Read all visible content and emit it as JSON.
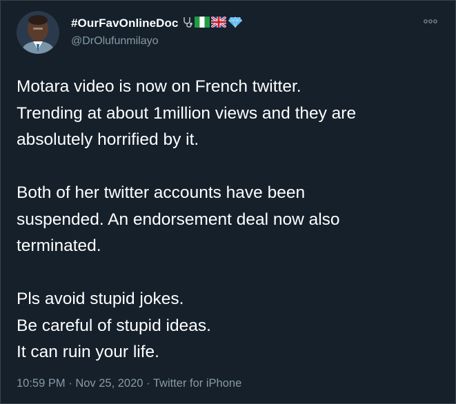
{
  "author": {
    "display_name": "#OurFavOnlineDoc",
    "handle": "@DrOlufunmilayo",
    "badges": [
      "stethoscope-icon",
      "nigeria-flag-icon",
      "uk-flag-icon",
      "gem-icon"
    ]
  },
  "tweet": {
    "paragraphs": [
      [
        "Motara video is now on French twitter.",
        "Trending at about 1million views and they are",
        "absolutely horrified by it."
      ],
      [
        "Both of her twitter accounts have been",
        "suspended. An endorsement deal now also",
        "terminated."
      ],
      [
        "Pls avoid stupid jokes.",
        "Be careful of stupid ideas.",
        "It can ruin your life."
      ]
    ]
  },
  "meta": {
    "time": "10:59 PM",
    "date": "Nov 25, 2020",
    "separator": "·",
    "source": "Twitter for iPhone"
  },
  "colors": {
    "background": "#15202b",
    "text_primary": "#ffffff",
    "text_secondary": "#8899a6",
    "border": "#38444d"
  },
  "icons": {
    "more": "more-options-icon"
  }
}
